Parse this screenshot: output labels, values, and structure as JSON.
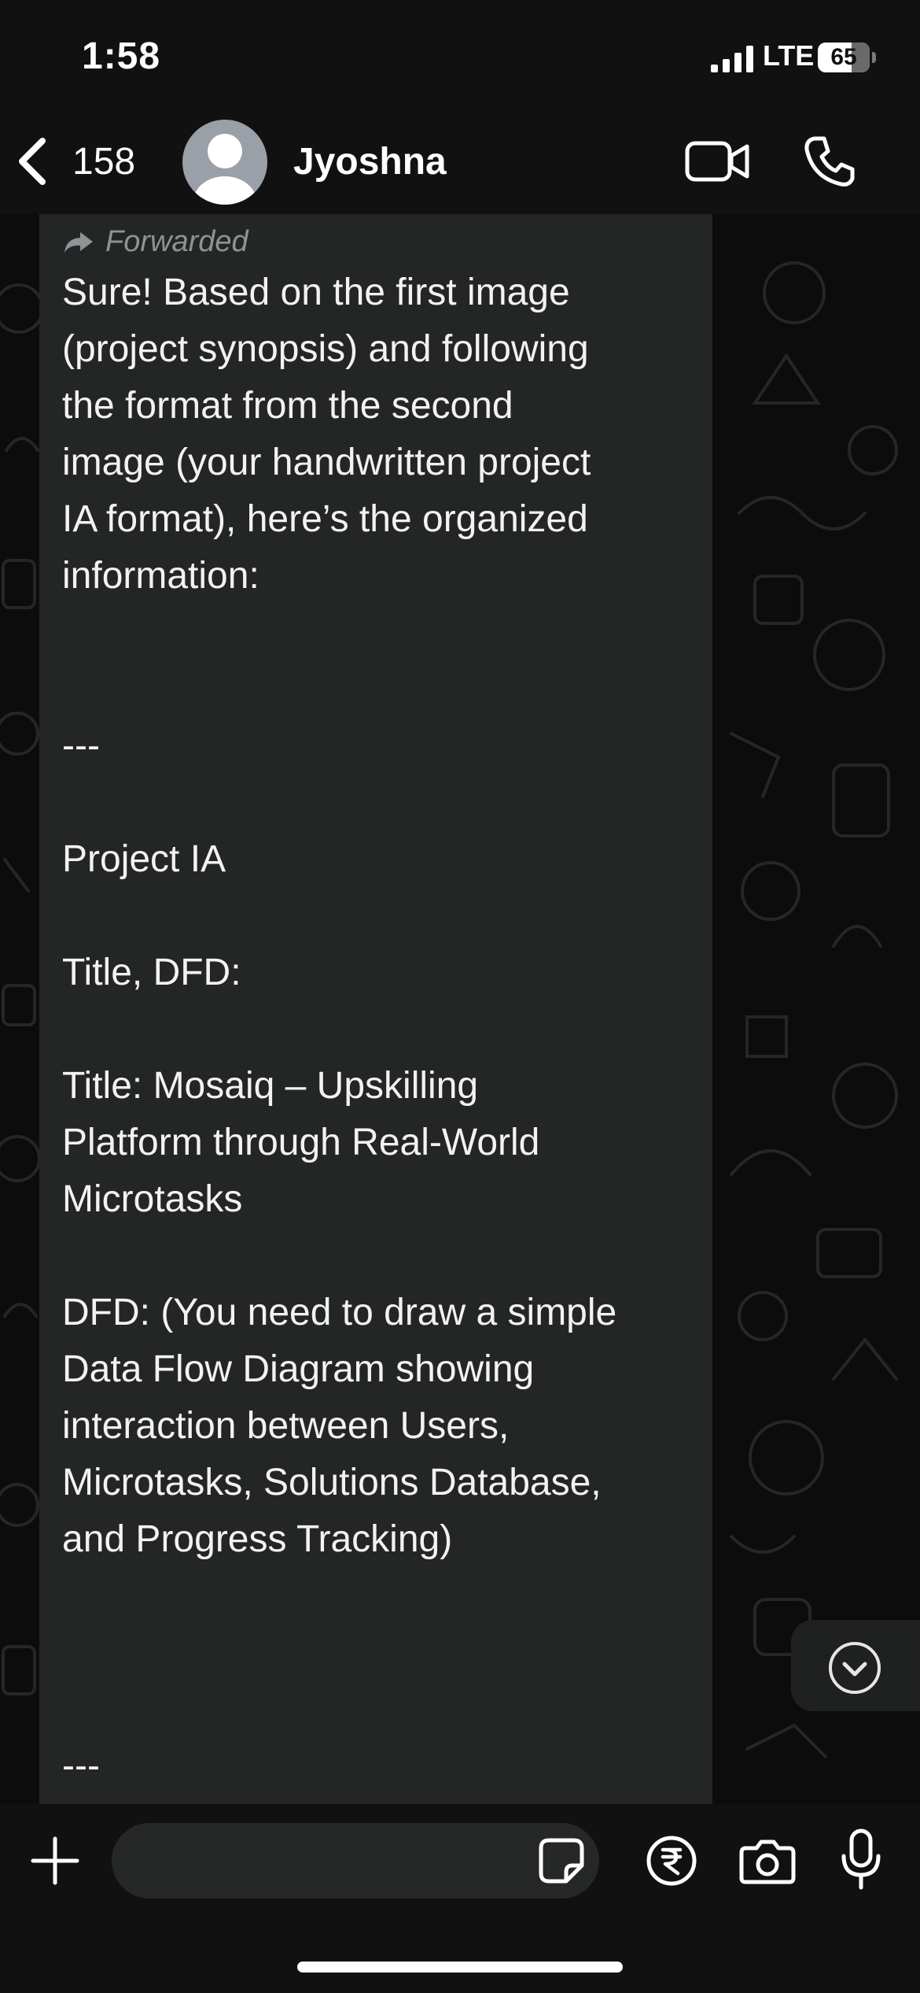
{
  "status_bar": {
    "time": "1:58",
    "network": "LTE",
    "battery": "65",
    "battery_level": 0.65
  },
  "header": {
    "back_count": "158",
    "contact_name": "Jyoshna",
    "icons": {
      "back": "chevron-left-icon",
      "avatar": "default-avatar",
      "video": "video-camera-icon",
      "call": "phone-icon"
    }
  },
  "message": {
    "forwarded_label": "Forwarded",
    "paragraphs": [
      "Sure! Based on the first image\n(project synopsis) and following\nthe format from the second\nimage (your handwritten project\nIA format), here’s the organized\ninformation:",
      "---",
      "Project IA",
      "Title, DFD:",
      "Title: Mosaiq – Upskilling\nPlatform through Real-World\nMicrotasks",
      "DFD: (You need to draw a simple\nData Flow Diagram showing\ninteraction between Users,\nMicrotasks, Solutions Database,\nand Progress Tracking)",
      "---"
    ]
  },
  "input_bar": {
    "placeholder": "",
    "icons": {
      "attach": "plus-icon",
      "sticker": "sticker-icon",
      "payment": "rupee-icon",
      "camera": "camera-icon",
      "mic": "microphone-icon"
    }
  },
  "colors": {
    "background": "#0b0b0b",
    "bars": "#111111",
    "bubble": "#242626",
    "forwarded_text": "#8d9396",
    "text": "#f2f2f2"
  }
}
